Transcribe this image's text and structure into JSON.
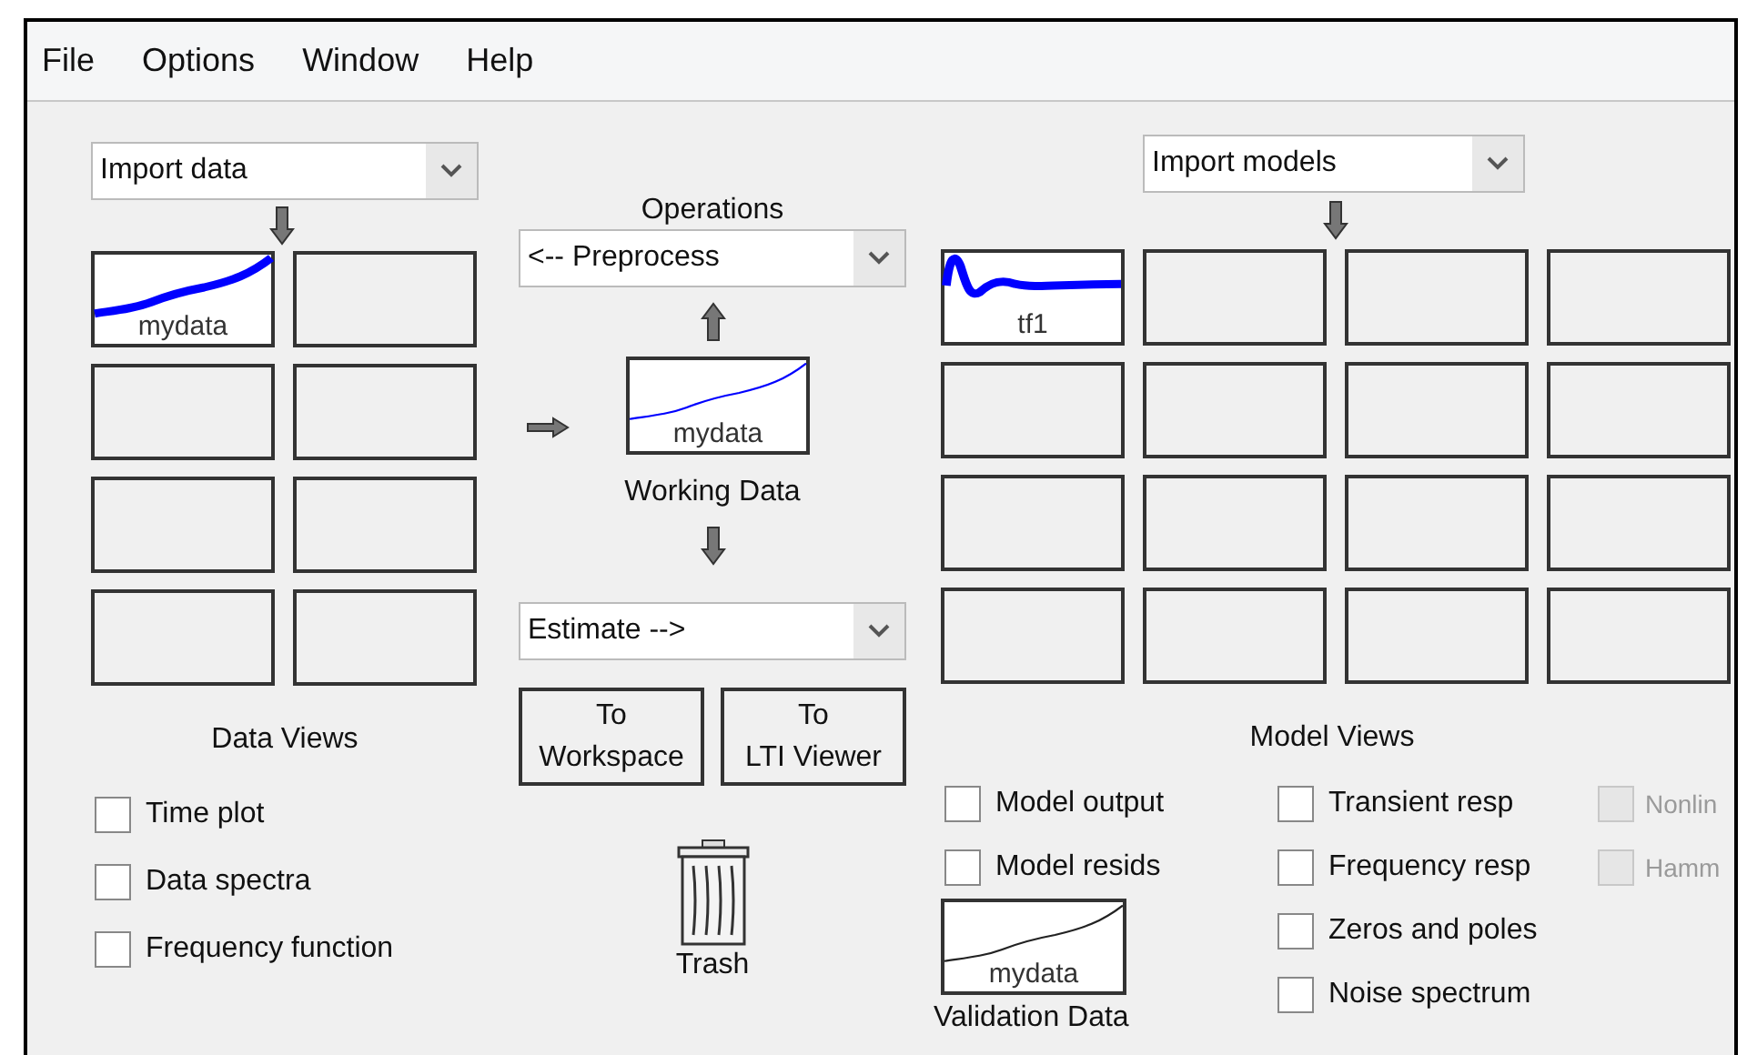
{
  "menu": [
    "File",
    "Options",
    "Window",
    "Help"
  ],
  "data": {
    "dropdown": "Import data",
    "slots": [
      {
        "kind": "rising",
        "label": "mydata"
      },
      {
        "kind": "empty"
      },
      {
        "kind": "empty"
      },
      {
        "kind": "empty"
      },
      {
        "kind": "empty"
      },
      {
        "kind": "empty"
      },
      {
        "kind": "empty"
      },
      {
        "kind": "empty"
      }
    ],
    "views_title": "Data Views",
    "views": [
      {
        "label": "Time plot",
        "checked": false,
        "disabled": false
      },
      {
        "label": "Data spectra",
        "checked": false,
        "disabled": false
      },
      {
        "label": "Frequency function",
        "checked": false,
        "disabled": false
      }
    ]
  },
  "operations": {
    "title": "Operations",
    "preprocess": "<-- Preprocess",
    "working": {
      "kind": "rising",
      "label": "mydata"
    },
    "working_title": "Working Data",
    "estimate": "Estimate -->",
    "buttons": [
      {
        "lines": [
          "To",
          "Workspace"
        ]
      },
      {
        "lines": [
          "To",
          "LTI Viewer"
        ]
      }
    ],
    "trash": "Trash"
  },
  "models": {
    "dropdown": "Import models",
    "slots": [
      {
        "kind": "damped",
        "label": "tf1"
      },
      {
        "kind": "empty"
      },
      {
        "kind": "empty"
      },
      {
        "kind": "empty"
      },
      {
        "kind": "empty"
      },
      {
        "kind": "empty"
      },
      {
        "kind": "empty"
      },
      {
        "kind": "empty"
      },
      {
        "kind": "empty"
      },
      {
        "kind": "empty"
      },
      {
        "kind": "empty"
      },
      {
        "kind": "empty"
      },
      {
        "kind": "empty"
      },
      {
        "kind": "empty"
      },
      {
        "kind": "empty"
      },
      {
        "kind": "empty"
      }
    ],
    "views_title": "Model Views",
    "view_columns": [
      [
        {
          "label": "Model output",
          "checked": false,
          "disabled": false
        },
        {
          "label": "Model resids",
          "checked": false,
          "disabled": false
        }
      ],
      [
        {
          "label": "Transient resp",
          "checked": false,
          "disabled": false
        },
        {
          "label": "Frequency resp",
          "checked": false,
          "disabled": false
        },
        {
          "label": "Zeros and poles",
          "checked": false,
          "disabled": false
        },
        {
          "label": "Noise spectrum",
          "checked": false,
          "disabled": false
        }
      ],
      [
        {
          "label": "Nonlin",
          "checked": false,
          "disabled": true
        },
        {
          "label": "Hamm",
          "checked": false,
          "disabled": true
        }
      ]
    ],
    "validation": {
      "kind": "rising",
      "label": "mydata"
    },
    "validation_title": "Validation Data"
  }
}
